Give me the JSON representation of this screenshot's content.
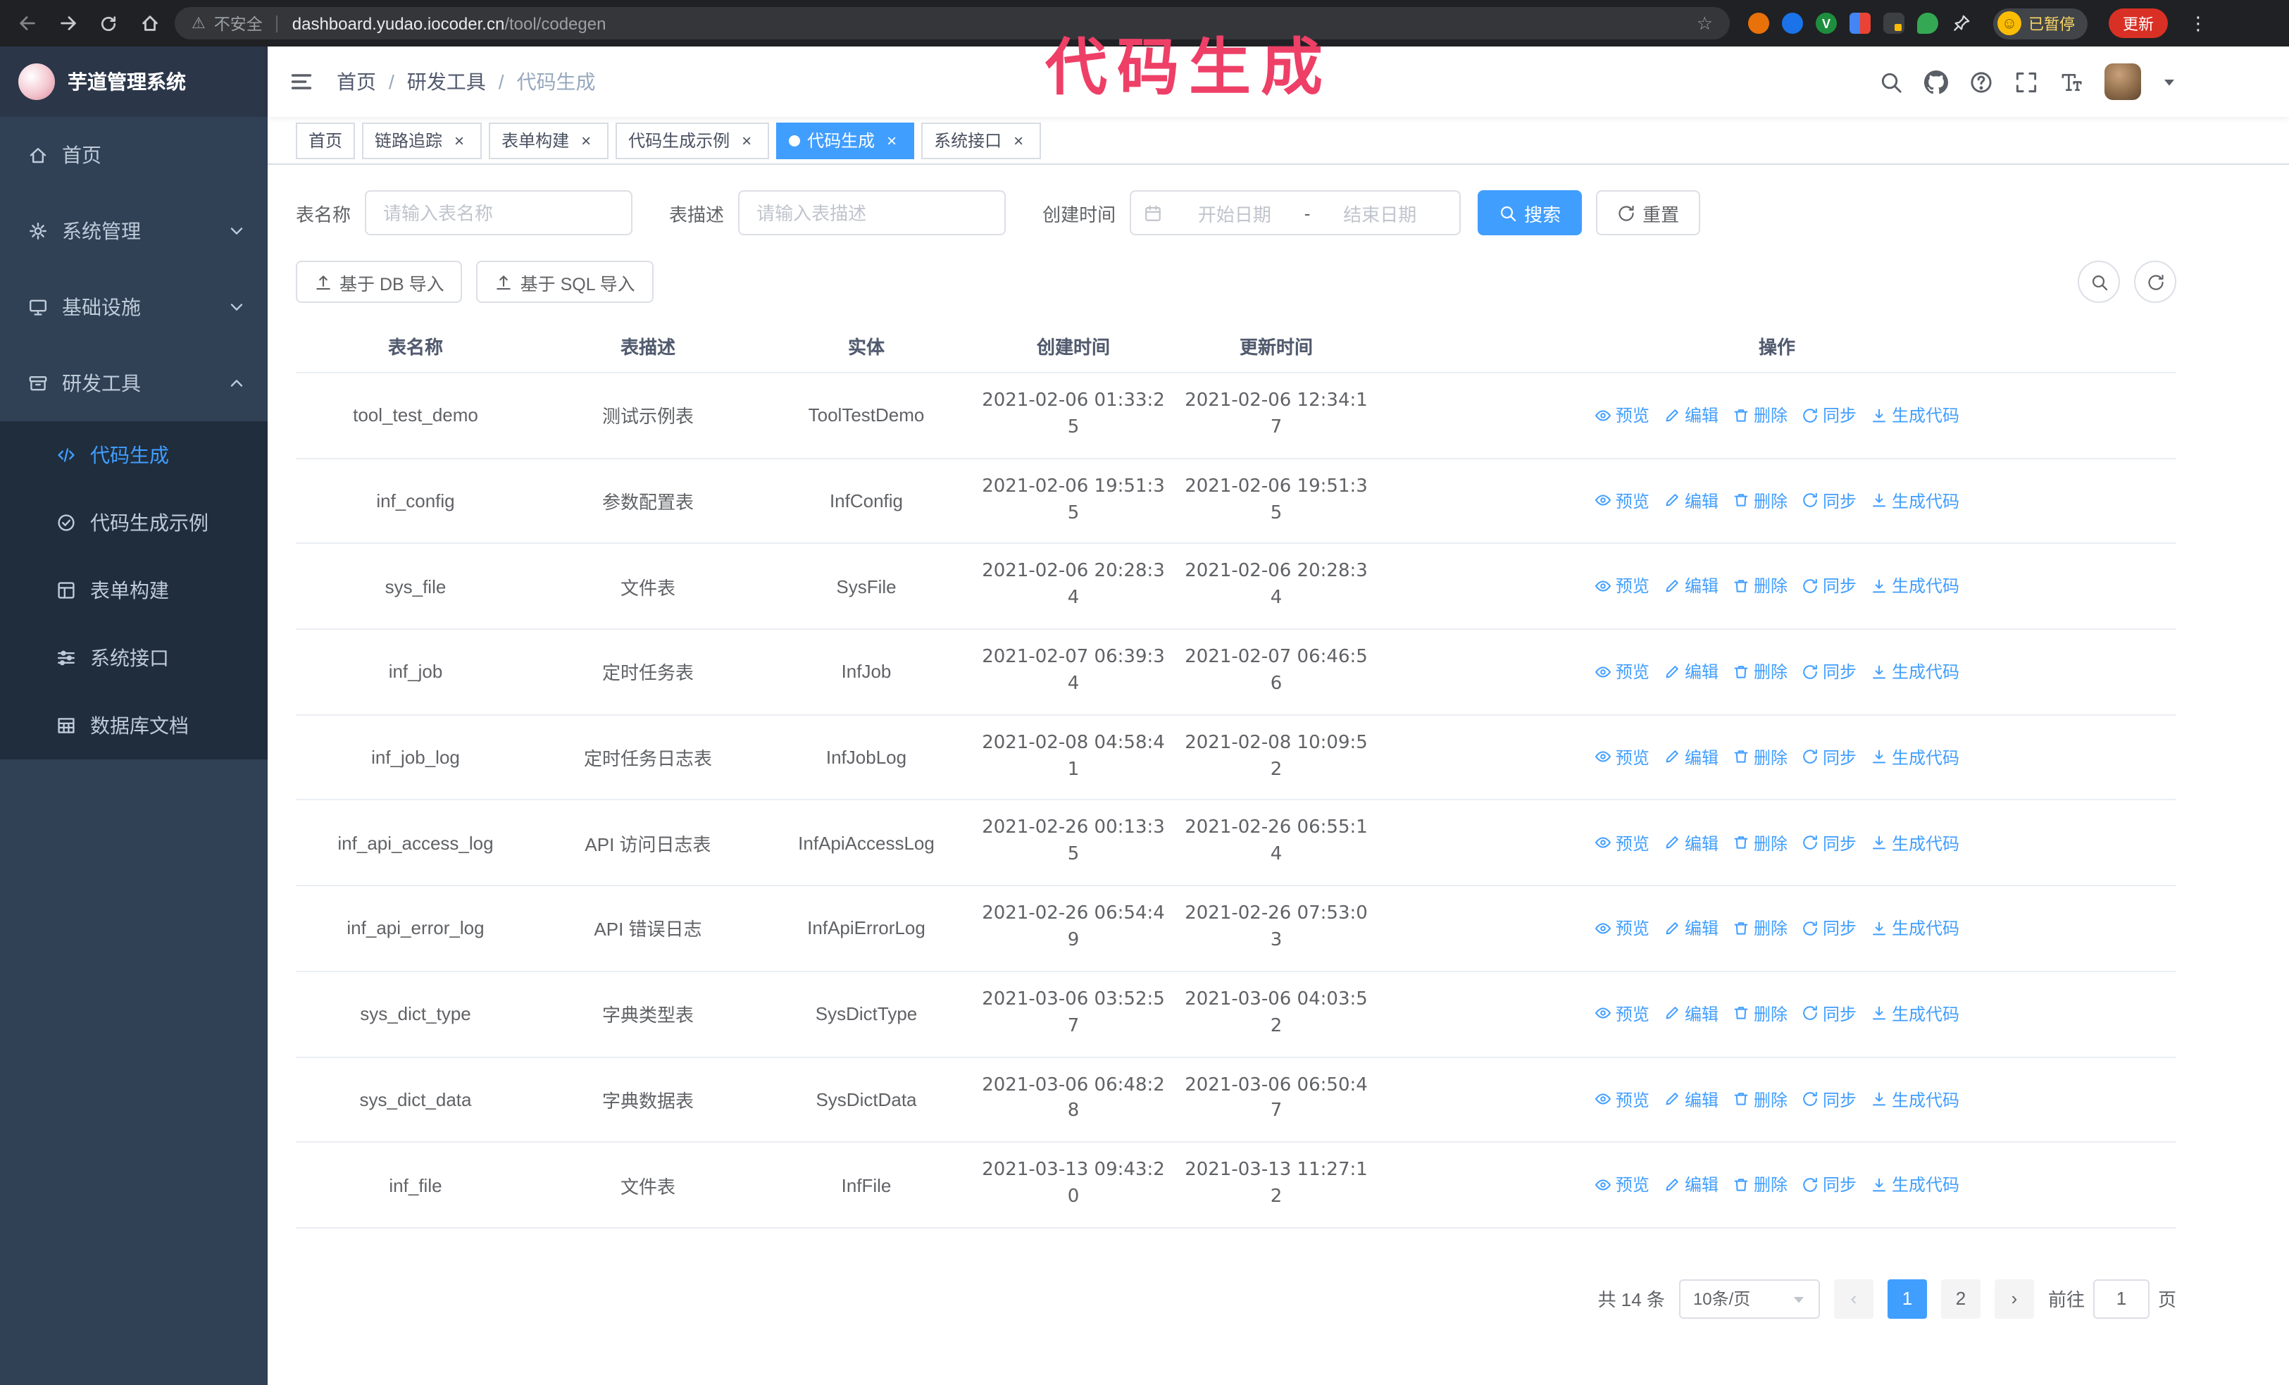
{
  "browser": {
    "security_label": "不安全",
    "url_host": "dashboard.yudao.iocoder.cn",
    "url_path": "/tool/codegen",
    "profile_chip_label": "已暂停",
    "update_button_label": "更新"
  },
  "icons": {
    "star": "☆",
    "warning": "⚠",
    "kebab": "⋮",
    "smiley": "☺",
    "close": "×",
    "ext_v": "V",
    "arrow_prev": "‹",
    "arrow_next": "›"
  },
  "annotation": {
    "text": "代码生成",
    "color": "#ee3f67"
  },
  "colors": {
    "accent": "#409eff",
    "sidebar_bg": "#304156",
    "submenu_bg": "#1f2d3d",
    "browser_bar_bg": "#202124",
    "annotation": "#ee3f67"
  },
  "sidebar": {
    "logo_title": "芋道管理系统",
    "items": [
      {
        "label": "首页",
        "icon": "home-icon"
      },
      {
        "label": "系统管理",
        "icon": "gear-icon"
      },
      {
        "label": "基础设施",
        "icon": "infra-icon"
      },
      {
        "label": "研发工具",
        "icon": "tools-icon"
      }
    ],
    "sub_items": [
      {
        "label": "代码生成",
        "icon": "code-icon",
        "active": true
      },
      {
        "label": "代码生成示例",
        "icon": "badge-icon",
        "active": false
      },
      {
        "label": "表单构建",
        "icon": "form-icon",
        "active": false
      },
      {
        "label": "系统接口",
        "icon": "api-icon",
        "active": false
      },
      {
        "label": "数据库文档",
        "icon": "database-doc-icon",
        "active": false
      }
    ]
  },
  "header": {
    "breadcrumb": [
      "首页",
      "研发工具",
      "代码生成"
    ],
    "separator": "/"
  },
  "tabs": [
    {
      "label": "首页",
      "closable": false,
      "active": false
    },
    {
      "label": "链路追踪",
      "closable": true,
      "active": false
    },
    {
      "label": "表单构建",
      "closable": true,
      "active": false
    },
    {
      "label": "代码生成示例",
      "closable": true,
      "active": false
    },
    {
      "label": "代码生成",
      "closable": true,
      "active": true
    },
    {
      "label": "系统接口",
      "closable": true,
      "active": false
    }
  ],
  "filters": {
    "table_name_label": "表名称",
    "table_name_placeholder": "请输入表名称",
    "table_desc_label": "表描述",
    "table_desc_placeholder": "请输入表描述",
    "create_time_label": "创建时间",
    "date_start_placeholder": "开始日期",
    "date_separator": "-",
    "date_end_placeholder": "结束日期",
    "search_label": "搜索",
    "reset_label": "重置"
  },
  "toolbar": {
    "import_db_label": "基于 DB 导入",
    "import_sql_label": "基于 SQL 导入"
  },
  "table": {
    "columns": [
      "表名称",
      "表描述",
      "实体",
      "创建时间",
      "更新时间",
      "操作"
    ],
    "ops": [
      {
        "label": "预览",
        "icon": "eye-icon"
      },
      {
        "label": "编辑",
        "icon": "edit-icon"
      },
      {
        "label": "删除",
        "icon": "delete-icon"
      },
      {
        "label": "同步",
        "icon": "sync-icon"
      },
      {
        "label": "生成代码",
        "icon": "download-icon"
      }
    ],
    "rows": [
      {
        "name": "tool_test_demo",
        "desc": "测试示例表",
        "entity": "ToolTestDemo",
        "created": "2021-02-06 01:33:25",
        "updated": "2021-02-06 12:34:17"
      },
      {
        "name": "inf_config",
        "desc": "参数配置表",
        "entity": "InfConfig",
        "created": "2021-02-06 19:51:35",
        "updated": "2021-02-06 19:51:35"
      },
      {
        "name": "sys_file",
        "desc": "文件表",
        "entity": "SysFile",
        "created": "2021-02-06 20:28:34",
        "updated": "2021-02-06 20:28:34"
      },
      {
        "name": "inf_job",
        "desc": "定时任务表",
        "entity": "InfJob",
        "created": "2021-02-07 06:39:34",
        "updated": "2021-02-07 06:46:56"
      },
      {
        "name": "inf_job_log",
        "desc": "定时任务日志表",
        "entity": "InfJobLog",
        "created": "2021-02-08 04:58:41",
        "updated": "2021-02-08 10:09:52"
      },
      {
        "name": "inf_api_access_log",
        "desc": "API 访问日志表",
        "entity": "InfApiAccessLog",
        "created": "2021-02-26 00:13:35",
        "updated": "2021-02-26 06:55:14"
      },
      {
        "name": "inf_api_error_log",
        "desc": "API 错误日志",
        "entity": "InfApiErrorLog",
        "created": "2021-02-26 06:54:49",
        "updated": "2021-02-26 07:53:03"
      },
      {
        "name": "sys_dict_type",
        "desc": "字典类型表",
        "entity": "SysDictType",
        "created": "2021-03-06 03:52:57",
        "updated": "2021-03-06 04:03:52"
      },
      {
        "name": "sys_dict_data",
        "desc": "字典数据表",
        "entity": "SysDictData",
        "created": "2021-03-06 06:48:28",
        "updated": "2021-03-06 06:50:47"
      },
      {
        "name": "inf_file",
        "desc": "文件表",
        "entity": "InfFile",
        "created": "2021-03-13 09:43:20",
        "updated": "2021-03-13 11:27:12"
      }
    ]
  },
  "pagination": {
    "total_label": "共 14 条",
    "page_size_label": "10条/页",
    "pages": [
      "1",
      "2"
    ],
    "active_page": "1",
    "goto_label": "前往",
    "goto_value": "1",
    "goto_unit": "页"
  }
}
